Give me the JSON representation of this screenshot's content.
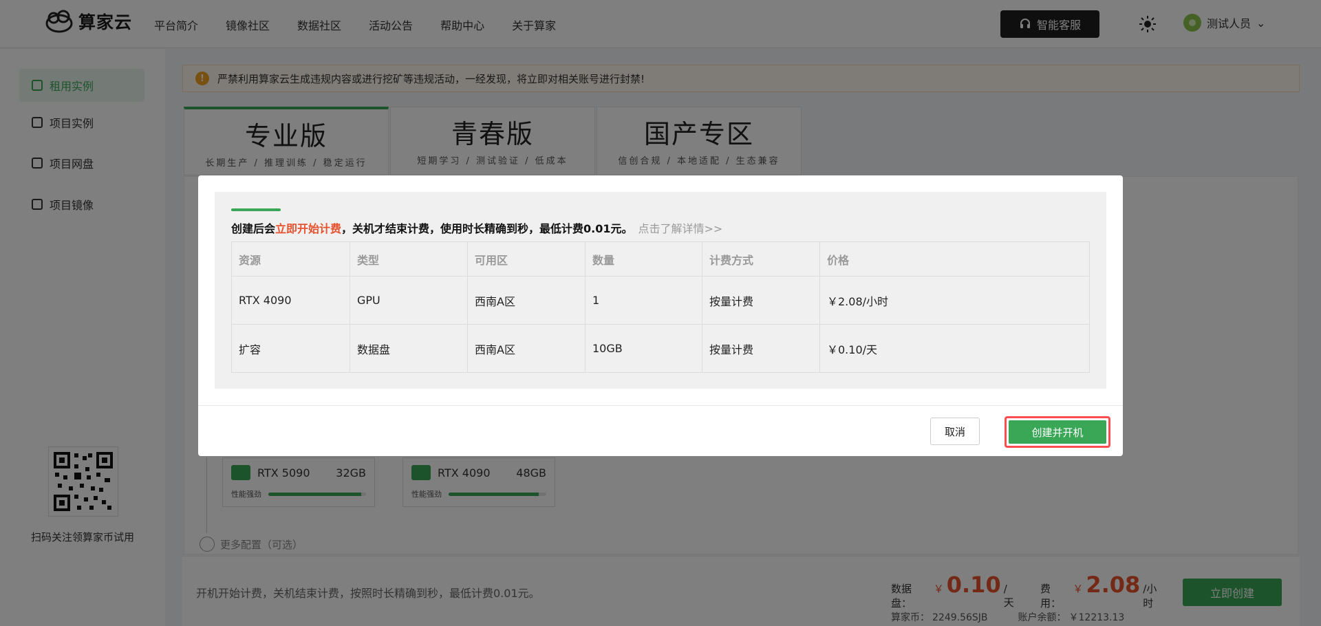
{
  "header": {
    "brand": "算家云",
    "nav": [
      "平台简介",
      "镜像社区",
      "数据社区",
      "活动公告",
      "帮助中心",
      "关于算家"
    ],
    "service_button": "智能客服",
    "user_name": "测试人员"
  },
  "sidebar": {
    "items": [
      {
        "label": "租用实例",
        "icon": "cloud-icon",
        "active": true
      },
      {
        "label": "项目实例",
        "icon": "layers-icon",
        "active": false
      },
      {
        "label": "项目网盘",
        "icon": "cloud-drive-icon",
        "active": false
      },
      {
        "label": "项目镜像",
        "icon": "image-stack-icon",
        "active": false
      }
    ],
    "qr_caption": "扫码关注领算家币试用"
  },
  "notice": "严禁利用算家云生成违规内容或进行挖矿等违规活动，一经发现，将立即对相关账号进行封禁!",
  "tabs": [
    {
      "title": "专业版",
      "subtitle": "长期生产 / 推理训练 / 稳定运行",
      "active": true
    },
    {
      "title": "青春版",
      "subtitle": "短期学习 / 测试验证 / 低成本",
      "active": false
    },
    {
      "title": "国产专区",
      "subtitle": "信创合规 / 本地适配 / 生态兼容",
      "active": false
    }
  ],
  "gpu_cards": [
    {
      "name": "RTX 5090",
      "memory": "32GB",
      "perf_label": "性能强劲",
      "perf": 0.95
    },
    {
      "name": "RTX 4090",
      "memory": "48GB",
      "perf_label": "性能强劲",
      "perf": 0.92
    }
  ],
  "more_config": "更多配置（可选）",
  "footer": {
    "note": "开机开始计费，关机结束计费，按照时长精确到秒，最低计费0.01元。",
    "disk_label": "数据盘：",
    "disk_currency": "￥",
    "disk_value": "0.10",
    "disk_unit": "/天",
    "fee_label": "费用：",
    "fee_currency": "￥",
    "fee_value": "2.08",
    "fee_unit": "/小时",
    "coins_label": "算家币：",
    "coins_value": "2249.56SJB",
    "balance_label": "账户余额：",
    "balance_value": "￥12213.13",
    "create_button": "立即创建"
  },
  "modal": {
    "msg_prefix": "创建后会",
    "msg_red": "立即开始计费",
    "msg_suffix": "，关机才结束计费，使用时长精确到秒，最低计费0.01元。",
    "msg_link": "点击了解详情>>",
    "table": {
      "headers": [
        "资源",
        "类型",
        "可用区",
        "数量",
        "计费方式",
        "价格"
      ],
      "rows": [
        [
          "RTX 4090",
          "GPU",
          "西南A区",
          "1",
          "按量计费",
          "￥2.08/小时"
        ],
        [
          "扩容",
          "数据盘",
          "西南A区",
          "10GB",
          "按量计费",
          "￥0.10/天"
        ]
      ]
    },
    "cancel": "取消",
    "confirm": "创建并开机"
  },
  "colors": {
    "accent": "#3aa757",
    "price_red": "#e8512d",
    "highlight": "#ff4d4f"
  }
}
